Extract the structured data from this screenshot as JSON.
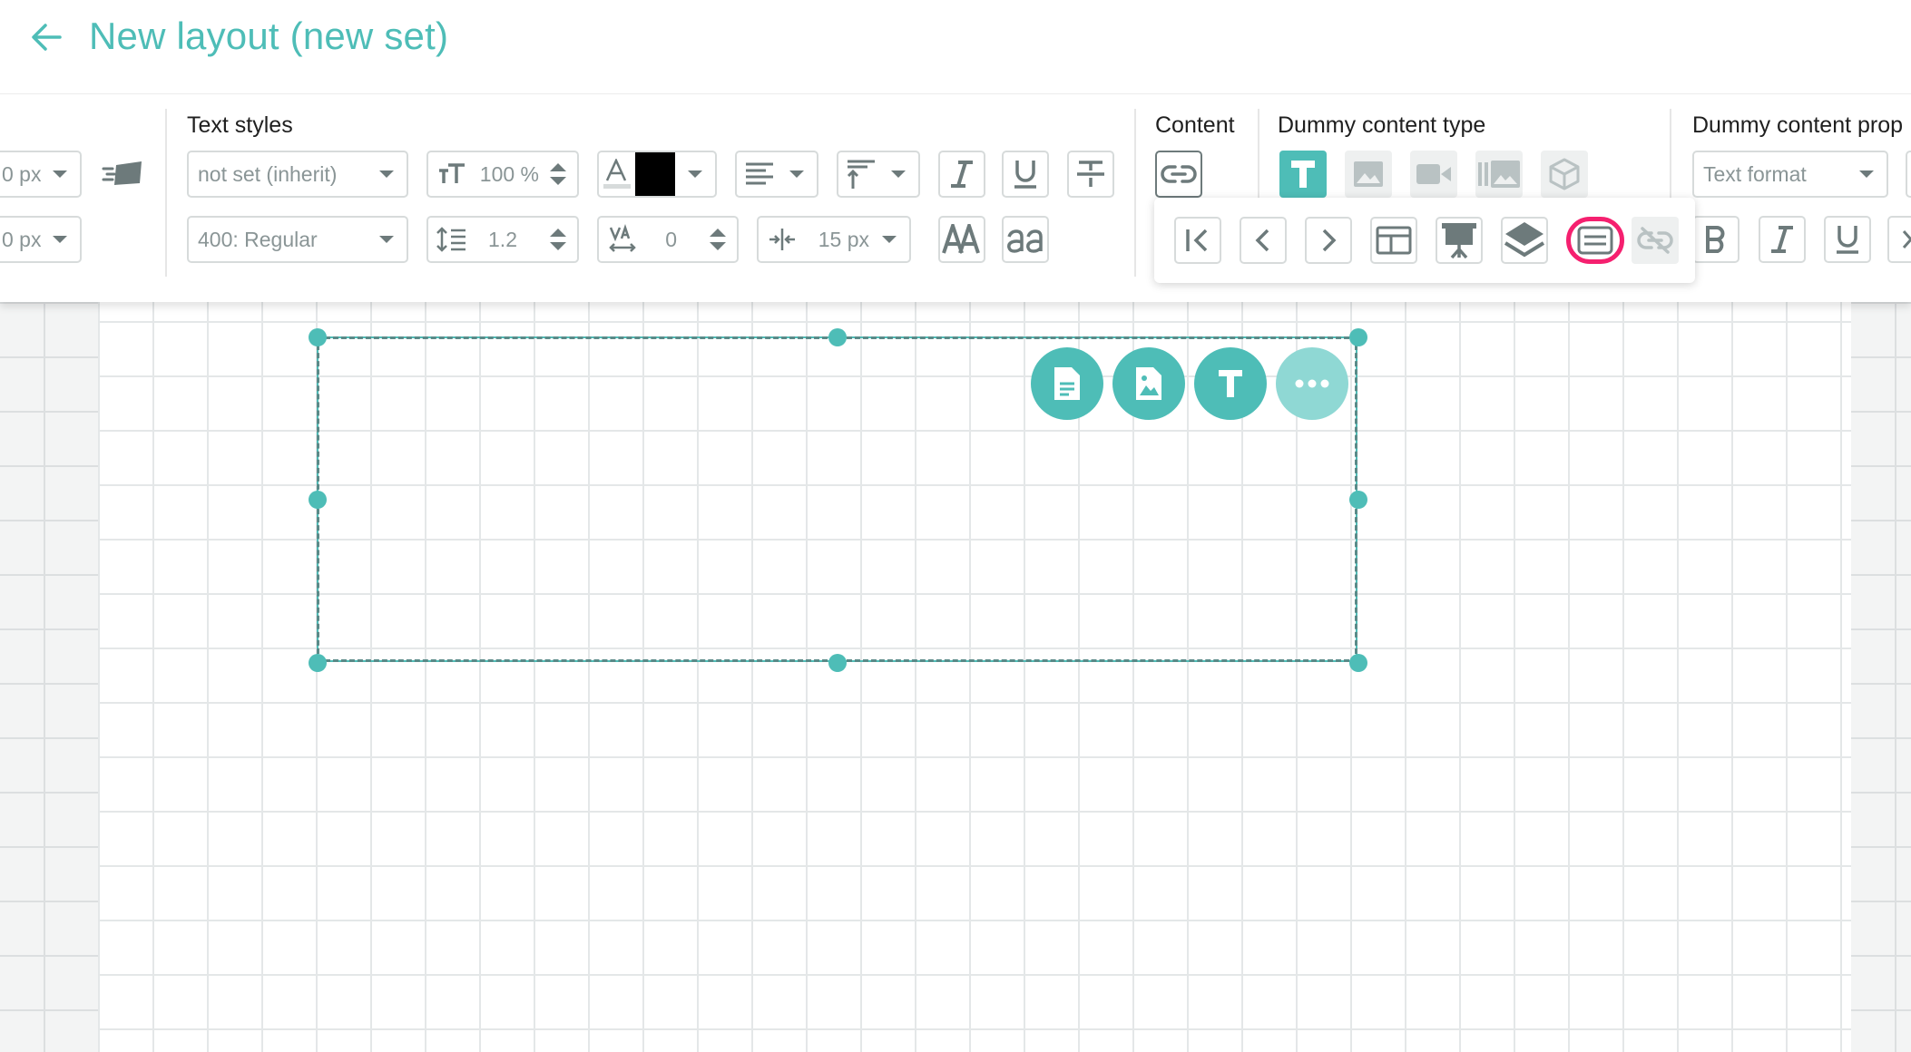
{
  "header": {
    "title": "New layout (new set)"
  },
  "toolbar": {
    "left": {
      "field1": "0 px",
      "field2": "0 px"
    },
    "text_styles": {
      "label": "Text styles",
      "font_family": "not set (inherit)",
      "font_weight": "400: Regular",
      "font_size": "100 %",
      "line_height": "1.2",
      "letter_spacing": "0",
      "indent": "15 px",
      "color": "#000000"
    },
    "content": {
      "label": "Content"
    },
    "dummy_type": {
      "label": "Dummy content type"
    },
    "dummy_props": {
      "label": "Dummy content prop",
      "text_format": "Text format"
    }
  },
  "colors": {
    "accent": "#4ebdb7",
    "accent_light": "#8fd8d4",
    "highlight": "#f5206f",
    "icon_gray": "#6d7a7b"
  }
}
